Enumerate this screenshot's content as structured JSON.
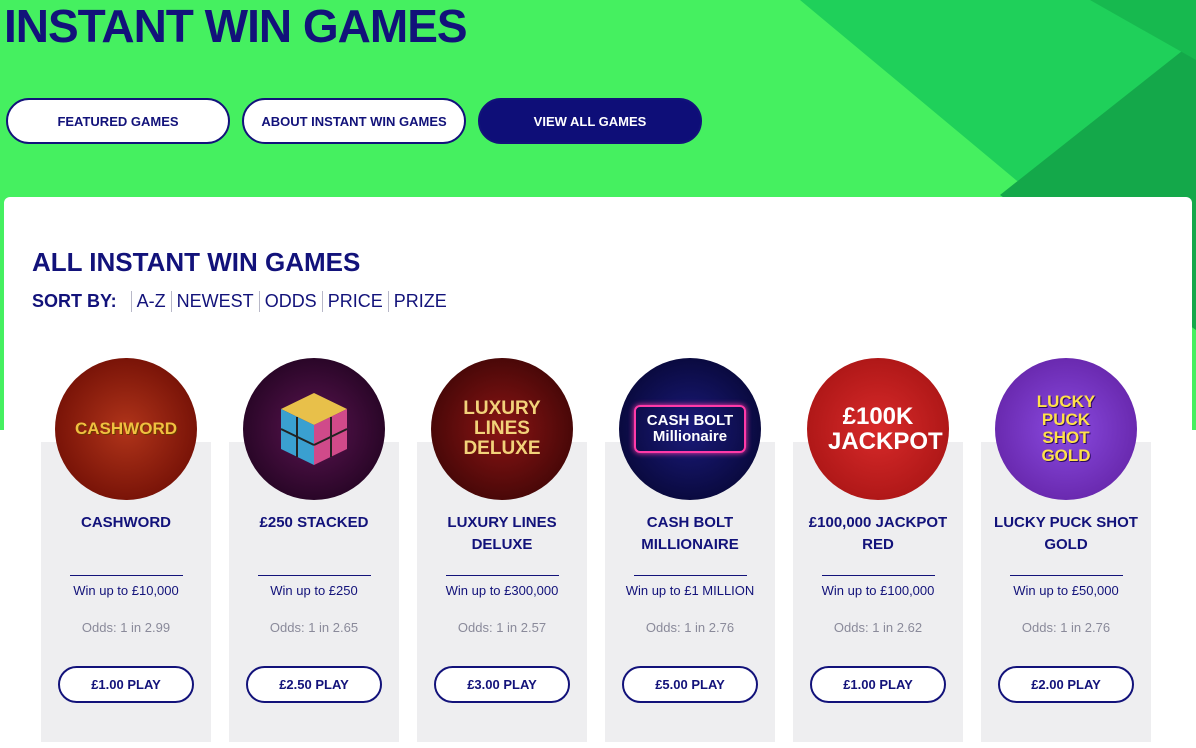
{
  "header": {
    "title": "INSTANT WIN GAMES",
    "tabs": [
      {
        "label": "FEATURED GAMES",
        "active": false
      },
      {
        "label": "ABOUT INSTANT WIN GAMES",
        "active": false
      },
      {
        "label": "VIEW ALL GAMES",
        "active": true
      }
    ]
  },
  "section": {
    "title": "ALL INSTANT WIN GAMES",
    "sort_label": "SORT BY:",
    "sort_options": [
      "A-Z",
      "NEWEST",
      "ODDS",
      "PRICE",
      "PRIZE"
    ]
  },
  "games": [
    {
      "logo": "CASHWORD",
      "name": "CASHWORD",
      "win": "Win up to £10,000",
      "odds": "Odds: 1 in 2.99",
      "play": "£1.00 PLAY",
      "color": "#8a1a0a"
    },
    {
      "logo": "",
      "name": "£250 STACKED",
      "win": "Win up to £250",
      "odds": "Odds: 1 in 2.65",
      "play": "£2.50 PLAY",
      "color": "#3a0a3a"
    },
    {
      "logo": "LUXURY LINES DELUXE",
      "name": "LUXURY LINES DELUXE",
      "win": "Win up to £300,000",
      "odds": "Odds: 1 in 2.57",
      "play": "£3.00 PLAY",
      "color": "#6a0e0e"
    },
    {
      "logo": "CASH BOLT Millionaire",
      "name": "CASH BOLT MILLIONAIRE",
      "win": "Win up to £1 MILLION",
      "odds": "Odds: 1 in 2.76",
      "play": "£5.00 PLAY",
      "color": "#0a0a4a"
    },
    {
      "logo": "£100K JACKPOT",
      "name": "£100,000 JACKPOT RED",
      "win": "Win up to £100,000",
      "odds": "Odds: 1 in 2.62",
      "play": "£1.00 PLAY",
      "color": "#b81a1a"
    },
    {
      "logo": "LUCKY PUCK SHOT GOLD",
      "name": "LUCKY PUCK SHOT GOLD",
      "win": "Win up to £50,000",
      "odds": "Odds: 1 in 2.76",
      "play": "£2.00 PLAY",
      "color": "#6a2ab0"
    }
  ]
}
